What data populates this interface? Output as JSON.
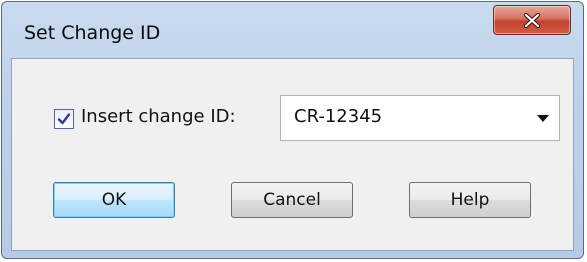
{
  "window": {
    "title": "Set Change ID",
    "close_icon": "close-x-icon"
  },
  "form": {
    "insert_change_id": {
      "label": "Insert change ID:",
      "checked": true
    },
    "change_id_combo": {
      "value": "CR-12345",
      "arrow_icon": "chevron-down-icon"
    }
  },
  "buttons": {
    "ok_label": "OK",
    "cancel_label": "Cancel",
    "help_label": "Help"
  },
  "colors": {
    "title_bar": "#bcd1ea",
    "close_button": "#c2412c",
    "default_button_border": "#3c7fb1",
    "client_background": "#f0f0f0"
  }
}
